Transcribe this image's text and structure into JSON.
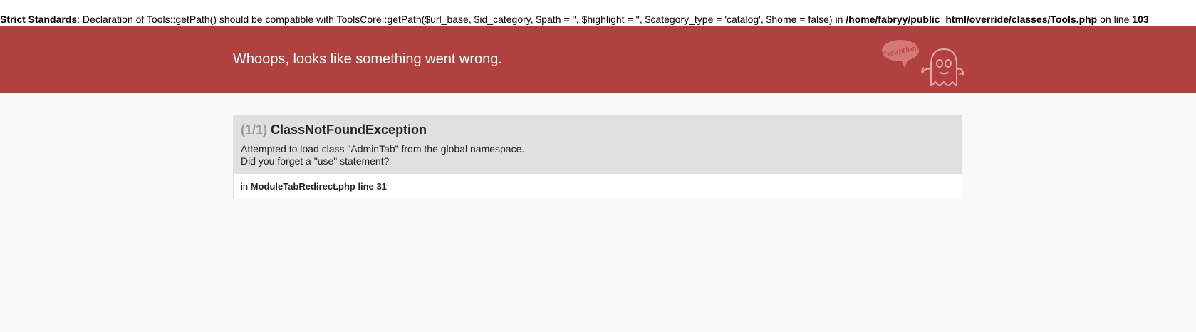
{
  "notice": {
    "label": "Strict Standards",
    "text": ": Declaration of Tools::getPath() should be compatible with ToolsCore::getPath($url_base, $id_category, $path = '', $highlight = '', $category_type = 'catalog', $home = false) in ",
    "file": "/home/fabryy/public_html/override/classes/Tools.php",
    "on_line": " on line ",
    "line": "103"
  },
  "header": {
    "title": "Whoops, looks like something went wrong.",
    "mascot_icon": "exception-ghost-icon",
    "mascot_text": "Exception!",
    "background": "#b0413e"
  },
  "exception": {
    "count": "(1/1)",
    "name": "ClassNotFoundException",
    "message_line1": "Attempted to load class \"AdminTab\" from the global namespace.",
    "message_line2": "Did you forget a \"use\" statement?",
    "trace_prefix": "in ",
    "trace_location": "ModuleTabRedirect.php line 31"
  }
}
